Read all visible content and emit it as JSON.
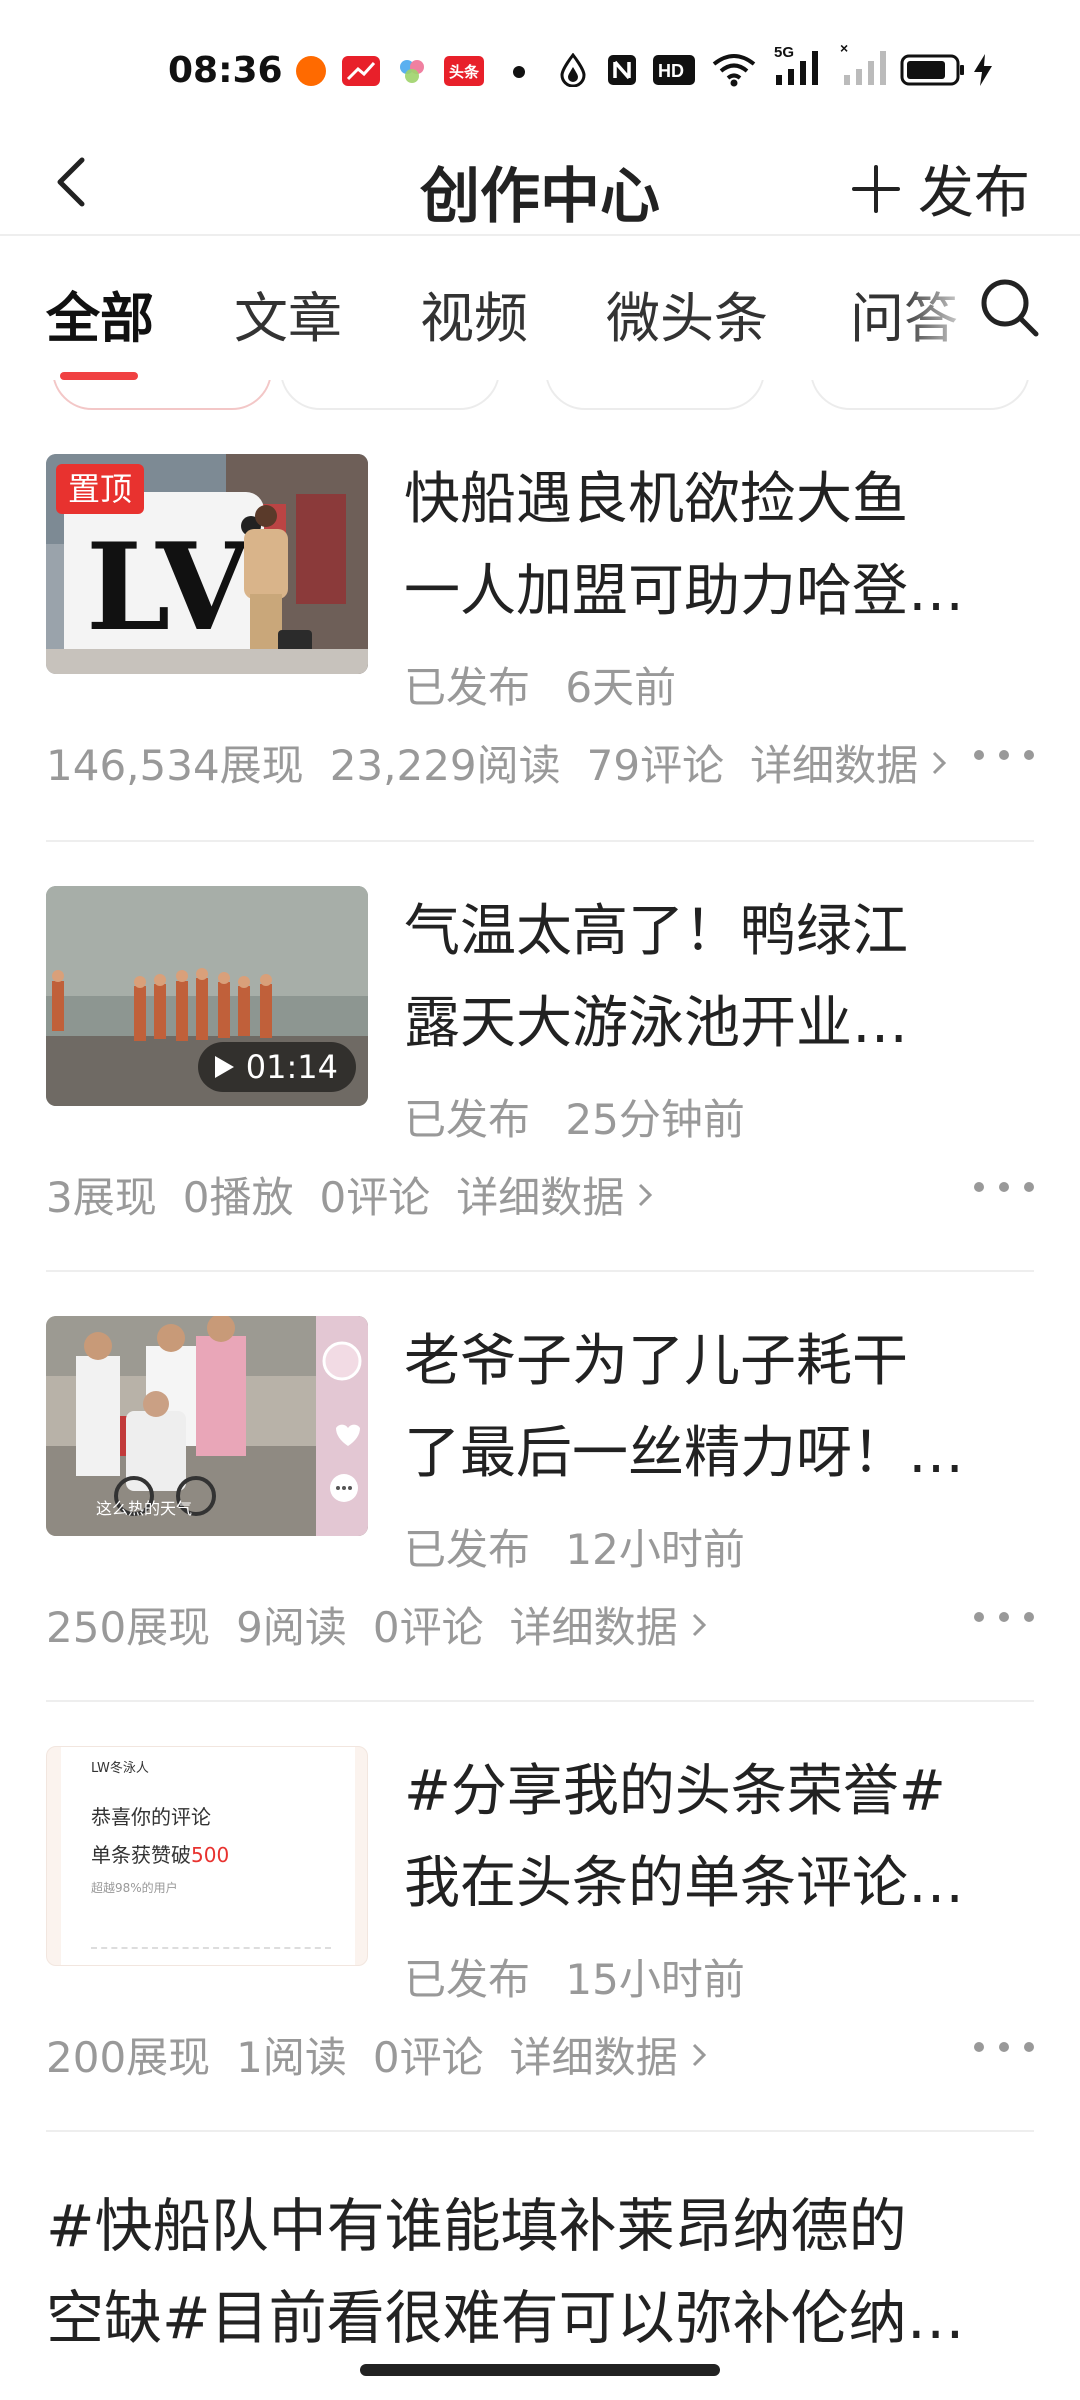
{
  "status_bar": {
    "time": "08:36",
    "notification_badge": "头条",
    "network": "5G",
    "icons": [
      "orange-app-icon",
      "red-trend-app-icon",
      "cloud-app-icon",
      "toutiao-app-icon",
      "dot-icon",
      "water-drop-icon",
      "nfc-icon",
      "hd-icon",
      "wifi-icon",
      "signal-5g-icon",
      "signal-2-icon",
      "battery-icon",
      "charging-icon"
    ]
  },
  "header": {
    "back_icon": "chevron-left-icon",
    "title": "创作中心",
    "publish_label": "发布",
    "publish_icon": "plus-icon"
  },
  "tabs": [
    {
      "label": "全部",
      "active": true
    },
    {
      "label": "文章",
      "active": false
    },
    {
      "label": "视频",
      "active": false
    },
    {
      "label": "微头条",
      "active": false
    },
    {
      "label": "问答",
      "active": false
    }
  ],
  "search_icon": "search-icon",
  "colors": {
    "accent": "#f04142",
    "badge": "#e8322f",
    "meta_text": "#999999",
    "title_text": "#222222"
  },
  "items": [
    {
      "title_lines": [
        "快船遇良机欲捡大鱼",
        "一人加盟可助力哈登…"
      ],
      "pinned_label": "置顶",
      "status": "已发布",
      "time": "6天前",
      "stats": [
        "146,534展现",
        "23,229阅读",
        "79评论"
      ],
      "detail_label": "详细数据"
    },
    {
      "title_lines": [
        "气温太高了！鸭绿江",
        "露天大游泳池开业…"
      ],
      "duration": "01:14",
      "status": "已发布",
      "time": "25分钟前",
      "stats": [
        "3展现",
        "0播放",
        "0评论"
      ],
      "detail_label": "详细数据"
    },
    {
      "title_lines": [
        "老爷子为了儿子耗干",
        "了最后一丝精力呀！…"
      ],
      "thumb_caption": "这么热的天气",
      "status": "已发布",
      "time": "12小时前",
      "stats": [
        "250展现",
        "9阅读",
        "0评论"
      ],
      "detail_label": "详细数据"
    },
    {
      "title_lines": [
        "#分享我的头条荣誉#",
        "我在头条的单条评论…"
      ],
      "thumb_card": {
        "app_tag": "LW冬泳人",
        "line1": "恭喜你的评论",
        "line2_prefix": "单条获赞破",
        "line2_number": "500",
        "line3": "超越98%的用户"
      },
      "status": "已发布",
      "time": "15小时前",
      "stats": [
        "200展现",
        "1阅读",
        "0评论"
      ],
      "detail_label": "详细数据"
    }
  ],
  "last_item": {
    "title_lines": [
      "#快船队中有谁能填补莱昂纳德的",
      "空缺#目前看很难有可以弥补伦纳…"
    ]
  }
}
